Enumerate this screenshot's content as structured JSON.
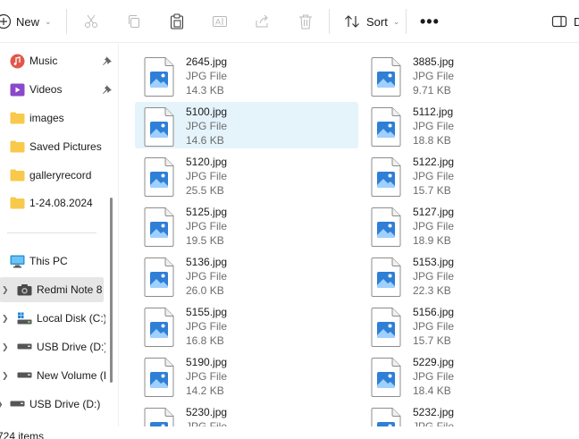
{
  "toolbar": {
    "new_label": "New",
    "sort_label": "Sort",
    "more_label": "•••",
    "details_label": "D",
    "icons": [
      "new-icon",
      "cut-icon",
      "copy-icon",
      "paste-icon",
      "rename-icon",
      "share-icon",
      "delete-icon",
      "sort-icon",
      "more-icon",
      "details-pane-icon"
    ]
  },
  "sidebar": {
    "quick_access": [
      {
        "label": "Music",
        "icon": "music-icon",
        "pinned": true
      },
      {
        "label": "Videos",
        "icon": "videos-icon",
        "pinned": true
      },
      {
        "label": "images",
        "icon": "folder-icon",
        "pinned": false
      },
      {
        "label": "Saved Pictures",
        "icon": "folder-icon",
        "pinned": false
      },
      {
        "label": "galleryrecord",
        "icon": "folder-icon",
        "pinned": false
      },
      {
        "label": "1-24.08.2024",
        "icon": "folder-icon",
        "pinned": false
      }
    ],
    "this_pc": {
      "label": "This PC",
      "icon": "pc-icon"
    },
    "devices": [
      {
        "label": "Redmi Note 8",
        "icon": "camera-icon",
        "selected": true
      },
      {
        "label": "Local Disk (C:)",
        "icon": "windows-drive-icon"
      },
      {
        "label": "USB Drive (D:)",
        "icon": "drive-icon"
      },
      {
        "label": "New Volume (I",
        "icon": "drive-icon"
      }
    ],
    "bottom_item": {
      "label": "USB Drive (D:)",
      "icon": "drive-icon"
    }
  },
  "files": [
    {
      "name": "2645.jpg",
      "type": "JPG File",
      "size": "14.3 KB"
    },
    {
      "name": "3885.jpg",
      "type": "JPG File",
      "size": "9.71 KB"
    },
    {
      "name": "5100.jpg",
      "type": "JPG File",
      "size": "14.6 KB",
      "selected": true
    },
    {
      "name": "5112.jpg",
      "type": "JPG File",
      "size": "18.8 KB"
    },
    {
      "name": "5120.jpg",
      "type": "JPG File",
      "size": "25.5 KB"
    },
    {
      "name": "5122.jpg",
      "type": "JPG File",
      "size": "15.7 KB"
    },
    {
      "name": "5125.jpg",
      "type": "JPG File",
      "size": "19.5 KB"
    },
    {
      "name": "5127.jpg",
      "type": "JPG File",
      "size": "18.9 KB"
    },
    {
      "name": "5136.jpg",
      "type": "JPG File",
      "size": "26.0 KB"
    },
    {
      "name": "5153.jpg",
      "type": "JPG File",
      "size": "22.3 KB"
    },
    {
      "name": "5155.jpg",
      "type": "JPG File",
      "size": "16.8 KB"
    },
    {
      "name": "5156.jpg",
      "type": "JPG File",
      "size": "15.7 KB"
    },
    {
      "name": "5190.jpg",
      "type": "JPG File",
      "size": "14.2 KB"
    },
    {
      "name": "5229.jpg",
      "type": "JPG File",
      "size": "18.4 KB"
    },
    {
      "name": "5230.jpg",
      "type": "JPG File",
      "size": ""
    },
    {
      "name": "5232.jpg",
      "type": "JPG File",
      "size": ""
    }
  ],
  "status": {
    "item_count": "724 items"
  },
  "colors": {
    "selection": "#e5f3fb",
    "nav_selected": "#e6e6e6",
    "image_icon_blue": "#2f7fd6",
    "folder_yellow": "#f8c94a"
  }
}
